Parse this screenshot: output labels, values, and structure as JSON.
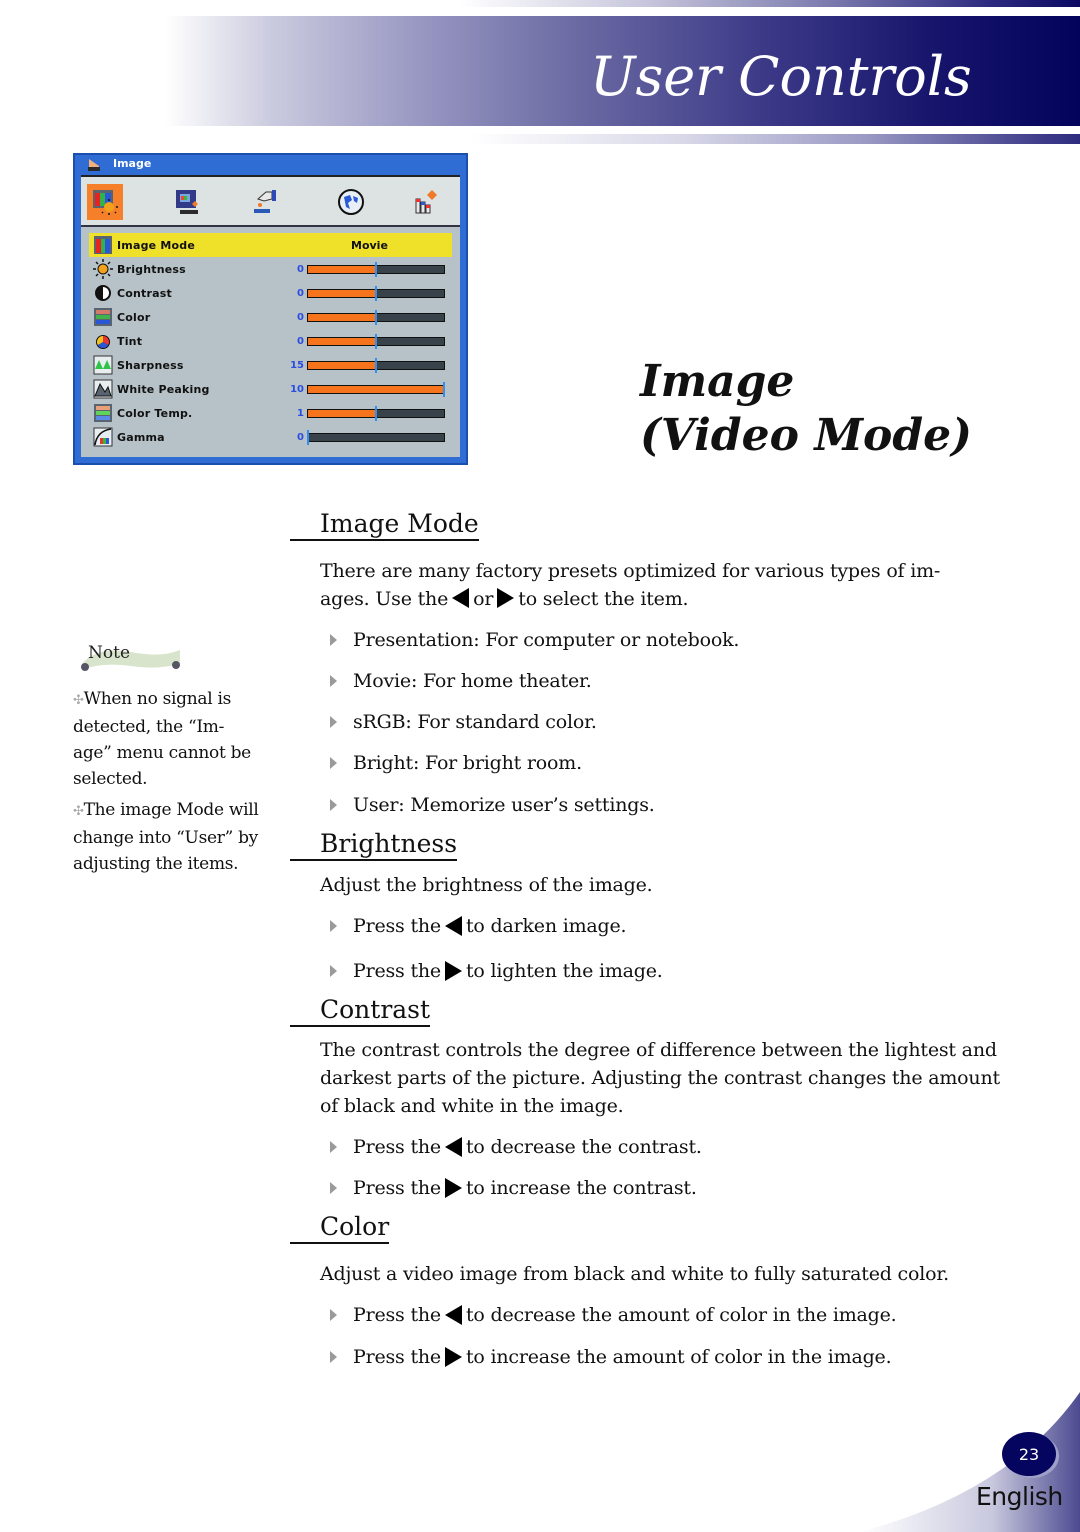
{
  "header": {
    "title": "User Controls"
  },
  "osd": {
    "title": "Image",
    "tabs": [
      {
        "name": "image",
        "icon": "image-settings-icon",
        "active": true
      },
      {
        "name": "screen",
        "icon": "screen-icon",
        "active": false
      },
      {
        "name": "setting",
        "icon": "hand-setting-icon",
        "active": false
      },
      {
        "name": "language",
        "icon": "globe-icon",
        "active": false
      },
      {
        "name": "options",
        "icon": "options-chart-icon",
        "active": false
      }
    ],
    "rows": [
      {
        "label": "Image Mode",
        "icon": "image-mode-icon",
        "text_value": "Movie",
        "selected": true
      },
      {
        "label": "Brightness",
        "icon": "brightness-icon",
        "value": "0",
        "fill": 0.5
      },
      {
        "label": "Contrast",
        "icon": "contrast-icon",
        "value": "0",
        "fill": 0.5
      },
      {
        "label": "Color",
        "icon": "color-icon",
        "value": "0",
        "fill": 0.5
      },
      {
        "label": "Tint",
        "icon": "tint-icon",
        "value": "0",
        "fill": 0.5
      },
      {
        "label": "Sharpness",
        "icon": "sharpness-icon",
        "value": "15",
        "fill": 0.5
      },
      {
        "label": "White Peaking",
        "icon": "white-peaking-icon",
        "value": "10",
        "fill": 1.0
      },
      {
        "label": "Color Temp.",
        "icon": "color-temp-icon",
        "value": "1",
        "fill": 0.5
      },
      {
        "label": "Gamma",
        "icon": "gamma-icon",
        "value": "0",
        "fill": 0.0
      }
    ]
  },
  "section_title": {
    "line1": "Image",
    "line2": "(Video Mode)"
  },
  "note": {
    "label": "Note",
    "items": [
      "When no signal is detected, the “Im-age” menu cannot be selected.",
      "The image Mode will change into “User” by adjusting the items."
    ],
    "lines1": [
      "When no signal is",
      "detected, the “Im-",
      "age” menu cannot be",
      "selected."
    ],
    "lines2": [
      "The image Mode will",
      "change into “User” by",
      "adjusting the items."
    ]
  },
  "sections": {
    "image_mode": {
      "heading": "Image Mode",
      "para_line1": "There are many factory presets optimized for various types of im-",
      "para_line2_a": "ages. Use the",
      "para_line2_b": "or",
      "para_line2_c": "to select the item.",
      "bullets": [
        "Presentation: For computer or notebook.",
        "Movie: For home theater.",
        "sRGB: For standard color.",
        "Bright: For bright room.",
        "User: Memorize user’s settings."
      ]
    },
    "brightness": {
      "heading": "Brightness",
      "para": "Adjust the brightness of the image.",
      "bullets": [
        {
          "pre": "Press the",
          "arrow": "left",
          "post": "to darken image."
        },
        {
          "pre": "Press the",
          "arrow": "right",
          "post": "to lighten the image."
        }
      ]
    },
    "contrast": {
      "heading": "Contrast",
      "para": "The contrast controls the degree of difference between the lightest and darkest parts of the picture. Adjusting the contrast changes the amount of black and white in the image.",
      "bullets": [
        {
          "pre": "Press the",
          "arrow": "left",
          "post": "to decrease the contrast."
        },
        {
          "pre": "Press the",
          "arrow": "right",
          "post": "to increase the contrast."
        }
      ]
    },
    "color": {
      "heading": "Color",
      "para": "Adjust a video image from black and white to fully saturated color.",
      "bullets": [
        {
          "pre": "Press the",
          "arrow": "left",
          "post": "to decrease the amount of color in the image."
        },
        {
          "pre": "Press the",
          "arrow": "right",
          "post": "to increase the amount of color in the image."
        }
      ]
    }
  },
  "footer": {
    "page_number": "23",
    "language": "English"
  },
  "colors": {
    "brand_navy": "#04035c",
    "osd_blue": "#2f6dd4",
    "osd_highlight": "#efe02a",
    "slider_fill": "#f6741c"
  }
}
